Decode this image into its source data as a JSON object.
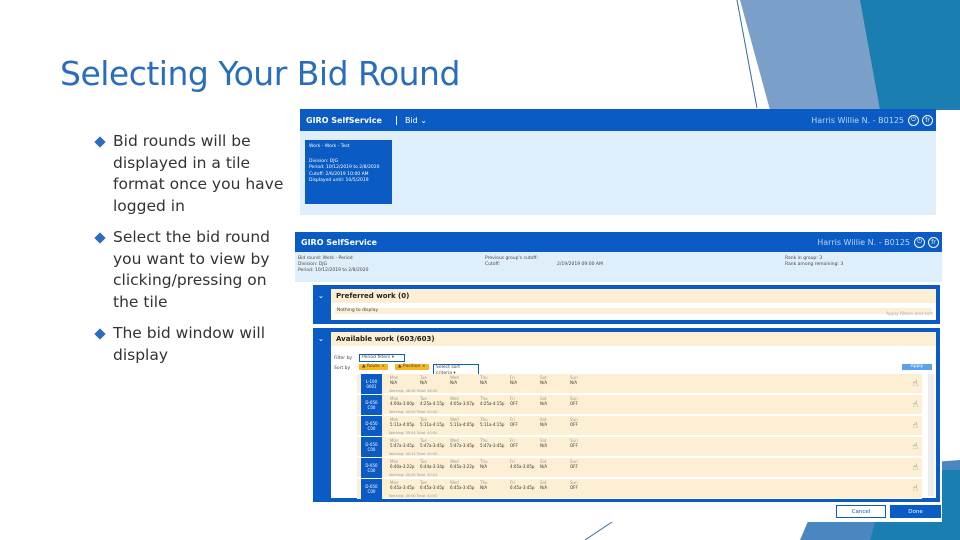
{
  "slide": {
    "title": "Selecting Your Bid Round",
    "bullets": [
      "Bid rounds will be displayed in a tile format once you have logged in",
      "Select the bid round you want to view by clicking/pressing on the tile",
      "The bid window will display"
    ]
  },
  "screen1": {
    "logo": "GIRO SelfService",
    "menu": "Bid ⌄",
    "user": "Harris Willie N. - B0125",
    "icons": [
      "logout-icon",
      "language-icon"
    ],
    "tile": {
      "title": "Work - Work - Test",
      "lines": [
        "Division: DJG",
        "Period: 10/12/2019 to 2/8/2020",
        "Cutoff: 2/6/2019 10:00 AM",
        "Displayed until: 10/5/2019"
      ]
    }
  },
  "screen2": {
    "logo": "GIRO SelfService",
    "user": "Harris Willie N. - B0125",
    "info": {
      "left": [
        "Bid round: Work - Period",
        "Division: DJG",
        "Period: 10/12/2019 to 2/8/2020"
      ],
      "mid": [
        "Previous group's cutoff:",
        "Cutoff:"
      ],
      "mid_val": "2/19/2019 09:00 AM",
      "right": [
        "Rank in group: 3",
        "Rank among remaining: 3"
      ]
    },
    "preferred": {
      "title": "Preferred work (0)",
      "empty": "Nothing to display",
      "hint": "Apply filters and sort"
    },
    "available": {
      "title": "Available work (603/603)",
      "filter_label": "Filter by",
      "filter_value": "Period filters",
      "sort_label": "Sort by",
      "sort_chips": [
        "▲ Route ×",
        "▲ Position ×"
      ],
      "sort_select": "Select sort criteria",
      "apply": "Apply",
      "days": [
        "Mon",
        "Tue",
        "Wed",
        "Thu",
        "Fri",
        "Sat",
        "Sun"
      ],
      "rows": [
        {
          "id": "L-100 0001",
          "cells": [
            "N/A",
            "N/A",
            "N/A",
            "N/A",
            "N/A",
            "N/A",
            "N/A"
          ],
          "foot": "Working: 48:00  Total: 48:00"
        },
        {
          "id": "D-050 C00",
          "cells": [
            "4:00a-3:00p",
            "4:25a-4:15p",
            "4:05a-3:07p",
            "4:25a-4:15p",
            "OFF",
            "N/A",
            "OFF"
          ],
          "foot": "Working: 40:00  Total: 40:00"
        },
        {
          "id": "D-050 C00",
          "cells": [
            "5:11a-4:05p",
            "5:11a-4:15p",
            "5:11a-4:05p",
            "5:11a-4:15p",
            "OFF",
            "N/A",
            "OFF"
          ],
          "foot": "Working: 39:54  Total: 40:00"
        },
        {
          "id": "D-050 C00",
          "cells": [
            "5:47a-3:45p",
            "5:47a-3:45p",
            "5:47a-3:45p",
            "5:47a-3:45p",
            "OFF",
            "N/A",
            "OFF"
          ],
          "foot": "Working: 40:12  Total: 40:00"
        },
        {
          "id": "D-050 C00",
          "cells": [
            "6:40a-3:22p",
            "6:44a-3:34p",
            "6:45a-3:22p",
            "N/A",
            "4:05a-3:05p",
            "N/A",
            "OFF"
          ],
          "foot": "Working: 40:00  Total: 40:24"
        },
        {
          "id": "D-050 C00",
          "cells": [
            "6:45a-3:45p",
            "6:45a-3:45p",
            "6:45a-3:45p",
            "N/A",
            "6:45a-3:45p",
            "N/A",
            "OFF"
          ],
          "foot": "Working: 40:00  Total: 40:00"
        }
      ]
    },
    "cancel": "Cancel",
    "done": "Done"
  },
  "colors": {
    "title": "#2a6ebb",
    "app_blue": "#0a5bc4",
    "row_bg": "#fdefd3",
    "tile_area": "#dfeefb"
  }
}
